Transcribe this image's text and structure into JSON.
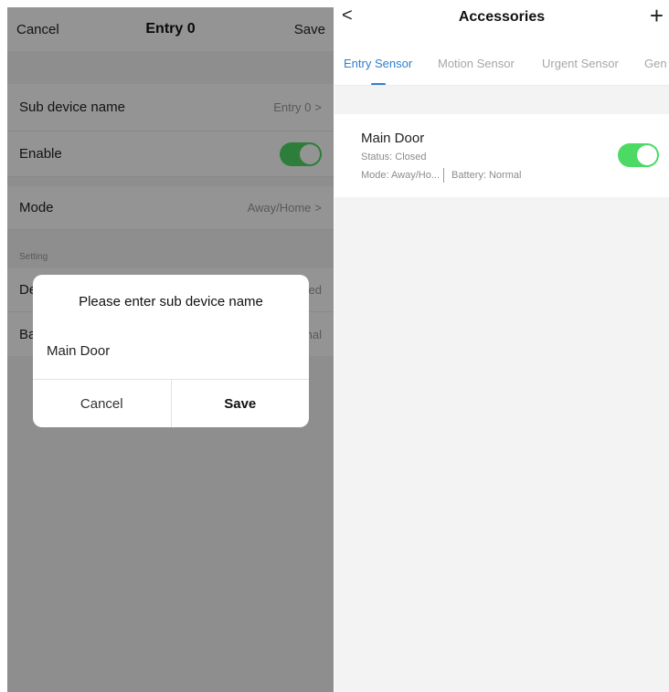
{
  "left": {
    "header": {
      "cancel": "Cancel",
      "title": "Entry 0",
      "save": "Save"
    },
    "rows": {
      "sub_device_name": {
        "label": "Sub device name",
        "value": "Entry 0"
      },
      "enable": {
        "label": "Enable",
        "on": true
      },
      "mode": {
        "label": "Mode",
        "value": "Away/Home"
      },
      "section": "Setting",
      "partial_row_1": {
        "label_visible": "De",
        "value_visible": "ed"
      },
      "partial_row_2": {
        "label_visible": "Ba",
        "value_visible": "nal"
      }
    },
    "chevron": ">",
    "dialog": {
      "title": "Please enter sub device name",
      "input_value": "Main Door",
      "cancel": "Cancel",
      "save": "Save"
    }
  },
  "right": {
    "header": {
      "back": "<",
      "title": "Accessories",
      "add": "+"
    },
    "tabs": [
      {
        "label": "Entry Sensor",
        "active": true
      },
      {
        "label": "Motion Sensor",
        "active": false
      },
      {
        "label": "Urgent Sensor",
        "active": false
      },
      {
        "label": "Gen",
        "active": false
      }
    ],
    "accessory": {
      "name": "Main Door",
      "status": "Status: Closed",
      "mode": "Mode: Away/Ho...",
      "battery": "Battery: Normal",
      "enabled": true
    }
  },
  "colors": {
    "accent_blue": "#2f7fcf",
    "toggle_green": "#4cd964",
    "overlay": "rgba(0,0,0,0.42)"
  }
}
